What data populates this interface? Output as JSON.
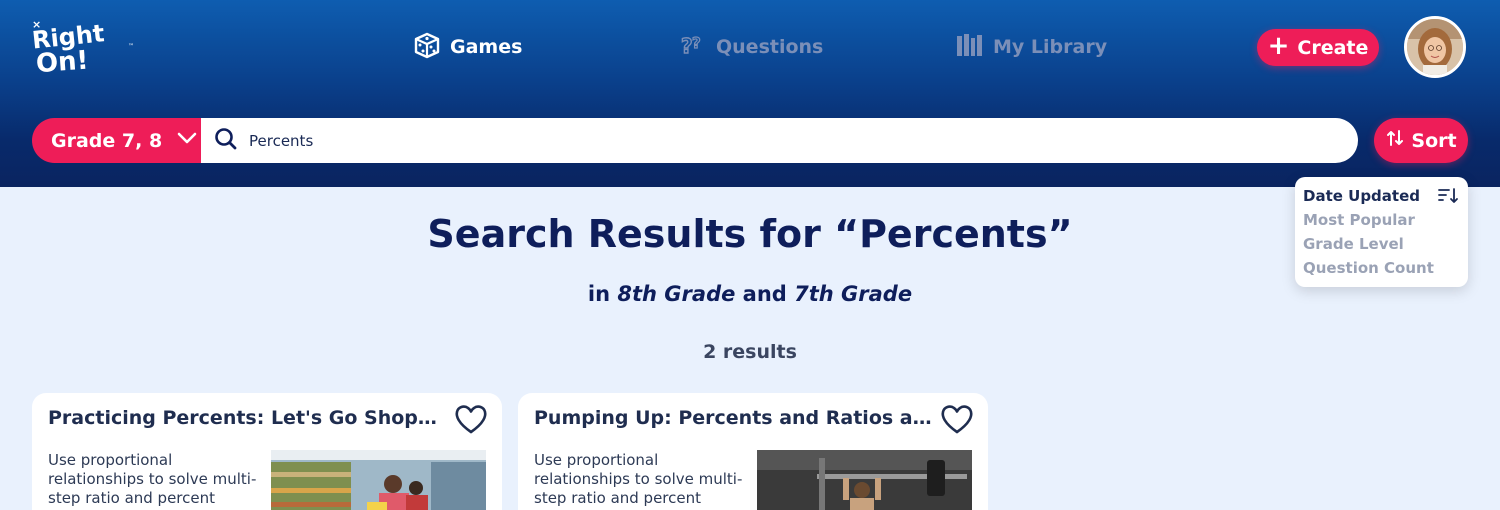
{
  "brand": {
    "logo_text": "RightOn!",
    "primary_color": "#ee1d58",
    "header_color": "#0a2f75"
  },
  "nav": {
    "games": {
      "label": "Games",
      "icon": "dice-icon",
      "active": true
    },
    "questions": {
      "label": "Questions",
      "icon": "questions-icon",
      "active": false
    },
    "library": {
      "label": "My Library",
      "icon": "library-icon",
      "active": false
    },
    "create": {
      "label": "Create",
      "icon": "plus-icon"
    }
  },
  "filter": {
    "grade_label": "Grade 7, 8"
  },
  "search": {
    "value": "Percents",
    "icon": "search-icon"
  },
  "sort": {
    "label": "Sort",
    "options": [
      {
        "label": "Date Updated",
        "selected": true
      },
      {
        "label": "Most Popular",
        "selected": false
      },
      {
        "label": "Grade Level",
        "selected": false
      },
      {
        "label": "Question Count",
        "selected": false
      }
    ]
  },
  "results": {
    "title": "Search Results for “Percents”",
    "sub_prefix": "in",
    "grade_a": "8th Grade",
    "sub_join": "and",
    "grade_b": "7th Grade",
    "count": "2 results"
  },
  "cards": [
    {
      "title": "Practicing Percents: Let's Go Shopping!",
      "description": "Use proportional relationships to solve multi-step ratio and percent"
    },
    {
      "title": "Pumping Up: Percents and Ratios at the Gym",
      "description": "Use proportional relationships to solve multi-step ratio and percent"
    }
  ]
}
